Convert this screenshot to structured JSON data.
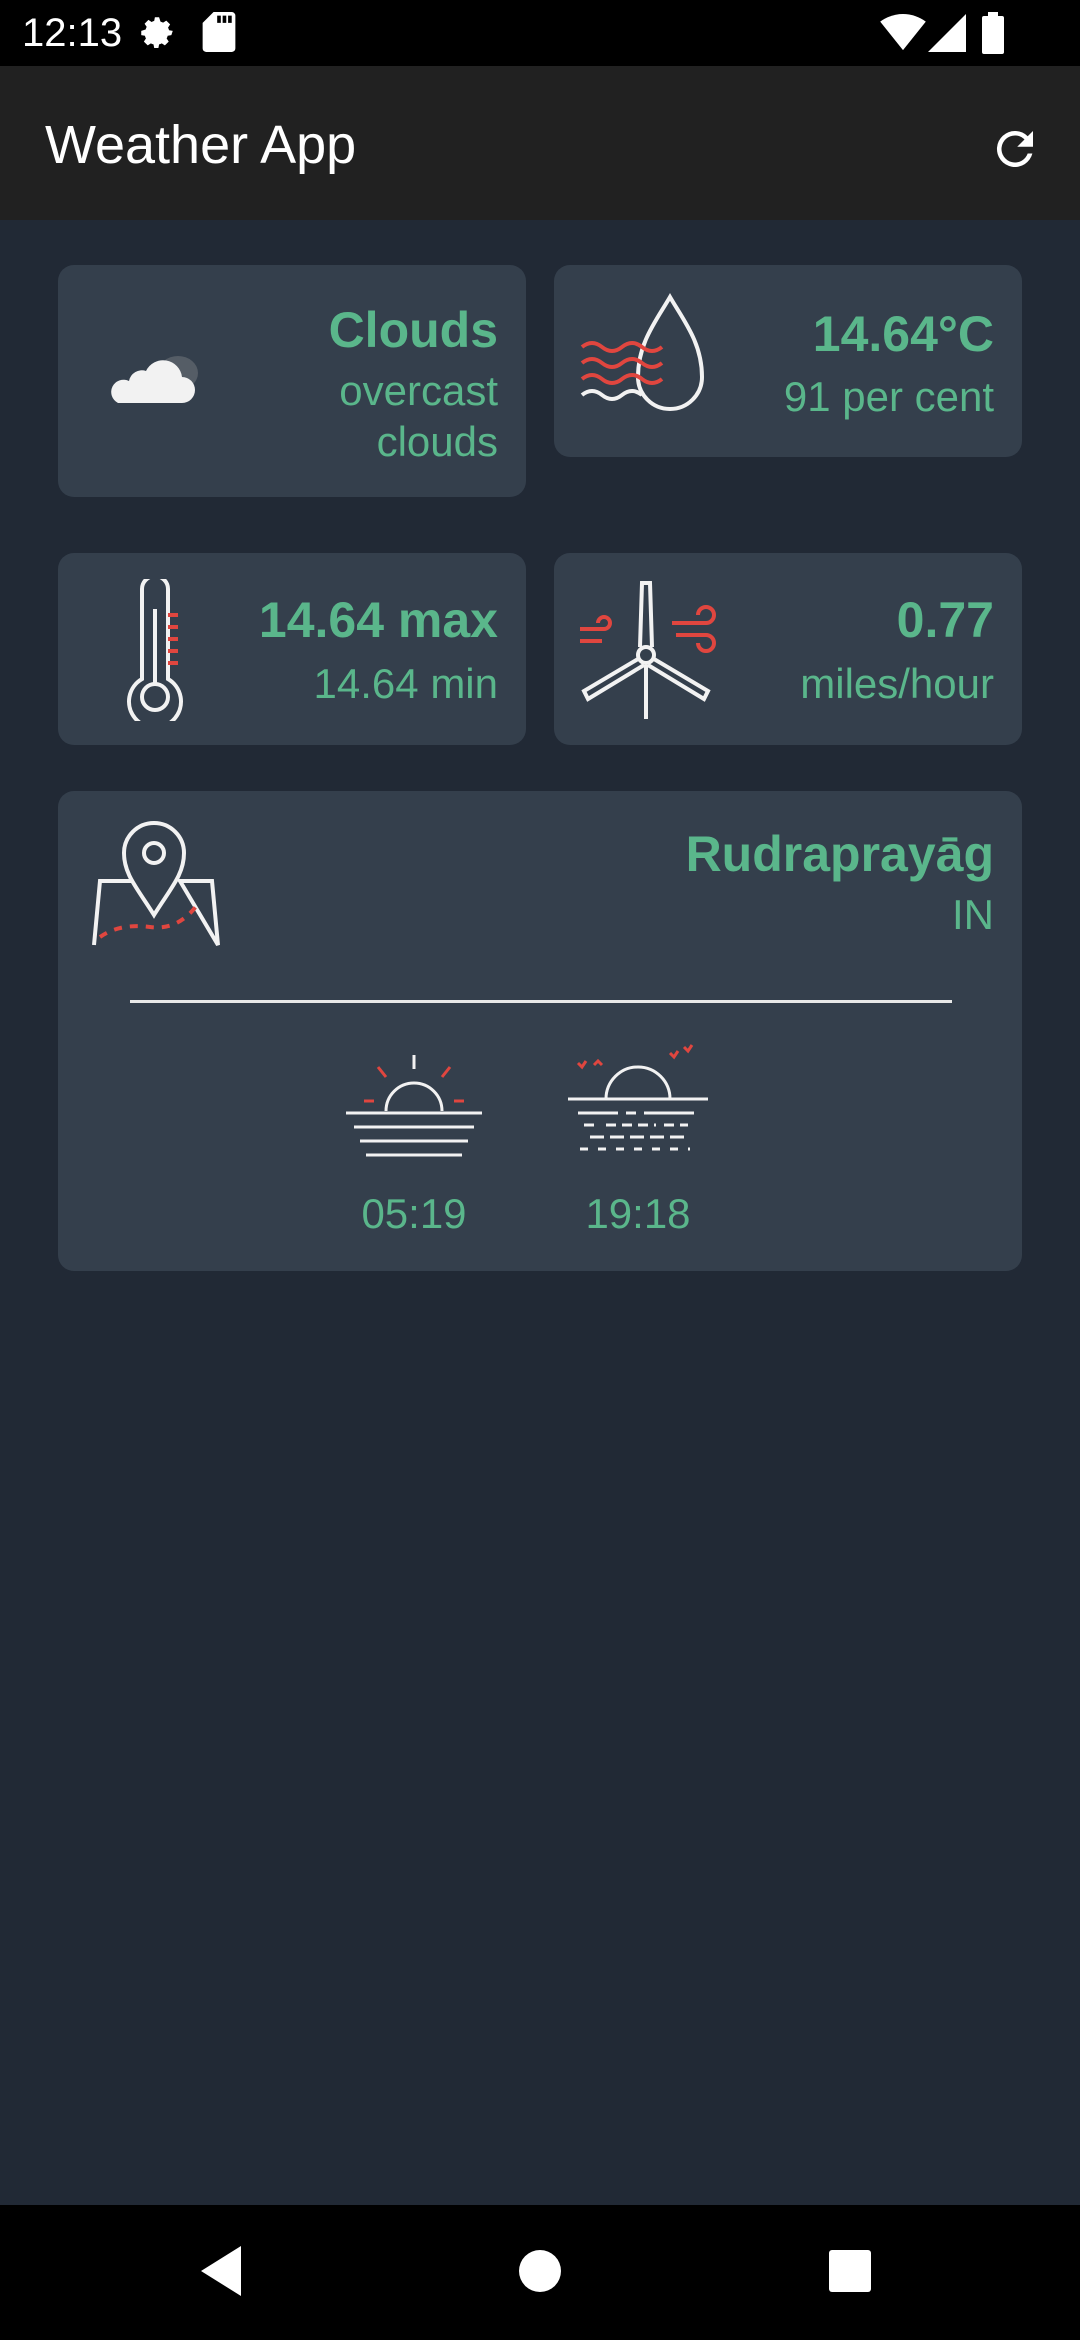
{
  "status_bar": {
    "time": "12:13",
    "icons": [
      "settings-icon",
      "sd-card-icon",
      "wifi-icon",
      "cellular-signal-icon",
      "battery-icon"
    ]
  },
  "app_bar": {
    "title": "Weather App",
    "refresh_icon": "refresh-icon"
  },
  "cards": {
    "weather": {
      "icon": "cloud-icon",
      "main": "Clouds",
      "description_line1": "overcast",
      "description_line2": "clouds"
    },
    "humidity": {
      "icon": "humidity-drop-icon",
      "temperature": "14.64°C",
      "humidity": "91 per cent"
    },
    "temperature": {
      "icon": "thermometer-icon",
      "max": "14.64 max",
      "min": "14.64 min"
    },
    "wind": {
      "icon": "wind-turbine-icon",
      "speed": "0.77",
      "unit": "miles/hour"
    },
    "location": {
      "icon": "map-pin-icon",
      "city": "Rudraprayāg",
      "country": "IN",
      "sunrise_icon": "sunrise-icon",
      "sunrise": "05:19",
      "sunset_icon": "sunset-icon",
      "sunset": "19:18"
    }
  },
  "nav_bar": {
    "back": "back-icon",
    "home": "home-icon",
    "recents": "recents-icon"
  },
  "colors": {
    "accent_green": "#5ab68b",
    "accent_red": "#e0463f",
    "card_bg": "#343f4c",
    "page_bg": "#212935",
    "app_bar_bg": "#212121"
  }
}
